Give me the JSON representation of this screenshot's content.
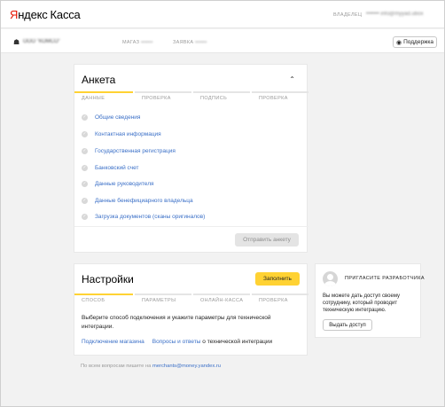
{
  "header": {
    "logo_brand": "Яндекс",
    "logo_product": "Касса",
    "owner_label": "ВЛАДЕЛЕЦ",
    "owner_value": "••••••• info@myyad.ubox"
  },
  "subheader": {
    "company_name": "ООО \"КОМСО\"",
    "shop_id_label": "МАГАЗ",
    "shop_id_value": "••••••",
    "request_label": "ЗАЯВКА",
    "request_value": "••••••",
    "support_label": "Поддержка"
  },
  "anketa": {
    "title": "Анкета",
    "steps": [
      "ДАННЫЕ",
      "ПРОВЕРКА",
      "ПОДПИСЬ",
      "ПРОВЕРКА"
    ],
    "active_step": 0,
    "items": [
      "Общие сведения",
      "Контактная информация",
      "Государственная регистрация",
      "Банковский счет",
      "Данные руководителя",
      "Данные бенефициарного владельца",
      "Загрузка документов (сканы оригиналов)"
    ],
    "send_button": "Отправить анкету"
  },
  "settings": {
    "title": "Настройки",
    "fill_button": "Заполнить",
    "steps": [
      "СПОСОБ",
      "ПАРАМЕТРЫ",
      "ОНЛАЙН-КАССА",
      "ПРОВЕРКА"
    ],
    "active_step": 0,
    "description": "Выберите способ подключения и укажите параметры для технической интеграции.",
    "link_connect": "Подключение магазина",
    "link_faq": "Вопросы и ответы",
    "link_suffix": " о технической интеграции"
  },
  "developer": {
    "title": "ПРИГЛАСИТЕ РАЗРАБОТЧИКА",
    "text": "Вы можете дать доступ своему сотруднику, который проводит техническую интеграцию.",
    "button": "Выдать доступ"
  },
  "footer": {
    "text": "По всем вопросам пишите на ",
    "email": "merchants@money.yandex.ru"
  },
  "colors": {
    "accent": "#ffd233",
    "link": "#3a6fc7",
    "brand_red": "#e61400"
  }
}
